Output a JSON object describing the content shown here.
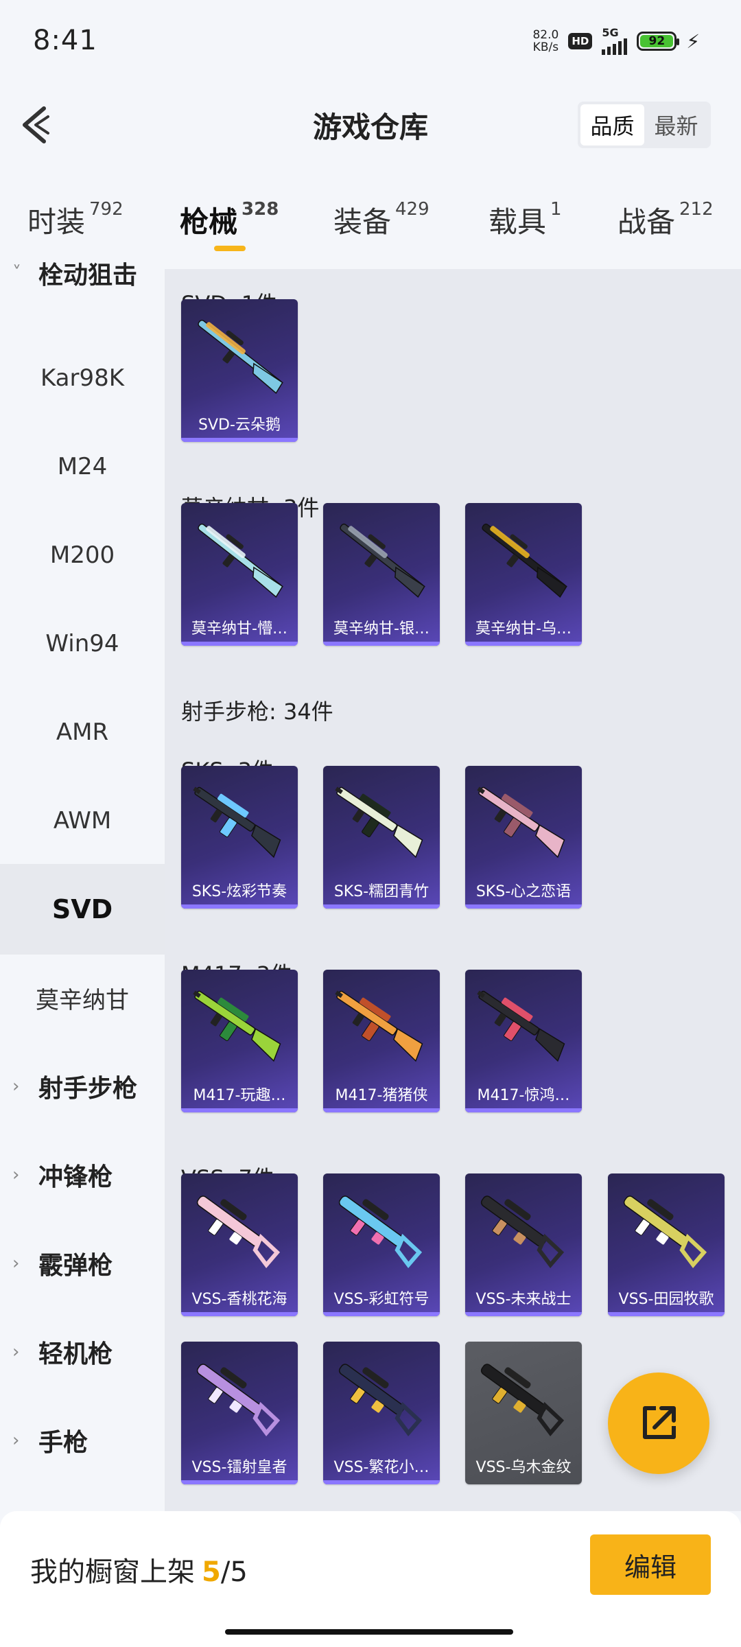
{
  "status_bar": {
    "time": "8:41",
    "net_speed_value": "82.0",
    "net_speed_unit": "KB/s",
    "hd": "HD",
    "network": "5G",
    "battery": "92"
  },
  "header": {
    "title": "游戏仓库",
    "sort_options": [
      "品质",
      "最新"
    ],
    "active_sort": "品质"
  },
  "tabs": [
    {
      "label": "时装",
      "count": "792"
    },
    {
      "label": "枪械",
      "count": "328",
      "active": true
    },
    {
      "label": "装备",
      "count": "429"
    },
    {
      "label": "载具",
      "count": "1"
    },
    {
      "label": "战备",
      "count": "212"
    }
  ],
  "sidebar": {
    "items": [
      {
        "label": "栓动狙击",
        "type": "group",
        "expanded": true
      },
      {
        "label": "Kar98K"
      },
      {
        "label": "M24"
      },
      {
        "label": "M200"
      },
      {
        "label": "Win94"
      },
      {
        "label": "AMR"
      },
      {
        "label": "AWM"
      },
      {
        "label": "SVD",
        "active": true
      },
      {
        "label": "莫辛纳甘"
      },
      {
        "label": "射手步枪",
        "type": "group"
      },
      {
        "label": "冲锋枪",
        "type": "group"
      },
      {
        "label": "霰弹枪",
        "type": "group"
      },
      {
        "label": "轻机枪",
        "type": "group"
      },
      {
        "label": "手枪",
        "type": "group"
      }
    ]
  },
  "content": {
    "sections": [
      {
        "title": "SVD: 1件",
        "items": [
          {
            "name": "SVD-云朵鹅",
            "color": "#7ec8e3",
            "accent": "#f0b040",
            "kind": "rifle"
          }
        ]
      },
      {
        "title": "莫辛纳甘: 3件",
        "items": [
          {
            "name": "莫辛纳甘-懵…",
            "color": "#a8e0e8",
            "accent": "#e8f4f8",
            "kind": "bolt"
          },
          {
            "name": "莫辛纳甘-银…",
            "color": "#3a3f4a",
            "accent": "#9aa3b0",
            "kind": "bolt"
          },
          {
            "name": "莫辛纳甘-乌…",
            "color": "#1e1e22",
            "accent": "#e8b420",
            "kind": "bolt"
          }
        ]
      },
      {
        "title": "射手步枪: 34件",
        "items": []
      },
      {
        "title": "SKS: 3件",
        "items": [
          {
            "name": "SKS-炫彩节奏",
            "color": "#2f3540",
            "accent": "#6ec8ff",
            "kind": "assault"
          },
          {
            "name": "SKS-糯团青竹",
            "color": "#e8efd8",
            "accent": "#1e2a1e",
            "kind": "assault"
          },
          {
            "name": "SKS-心之恋语",
            "color": "#e8b4c8",
            "accent": "#9a5a6a",
            "kind": "assault"
          }
        ]
      },
      {
        "title": "M417: 3件",
        "items": [
          {
            "name": "M417-玩趣…",
            "color": "#9ad43a",
            "accent": "#2c8a3c",
            "kind": "assault"
          },
          {
            "name": "M417-猪猪侠",
            "color": "#f0a040",
            "accent": "#c0502a",
            "kind": "assault"
          },
          {
            "name": "M417-惊鸿…",
            "color": "#2a2a30",
            "accent": "#e0506a",
            "kind": "assault"
          }
        ]
      },
      {
        "title": "VSS: 7件",
        "items": [
          {
            "name": "VSS-香桃花海",
            "color": "#f4c8d8",
            "accent": "#ffffff",
            "kind": "vss"
          },
          {
            "name": "VSS-彩虹符号",
            "color": "#6ac8f0",
            "accent": "#f070b0",
            "kind": "vss"
          },
          {
            "name": "VSS-未来战士",
            "color": "#2a2a2e",
            "accent": "#c89060",
            "kind": "vss"
          },
          {
            "name": "VSS-田园牧歌",
            "color": "#d8d060",
            "accent": "#ffffff",
            "kind": "vss"
          },
          {
            "name": "VSS-镭射皇者",
            "color": "#b890e0",
            "accent": "#f0e8ff",
            "kind": "vss"
          },
          {
            "name": "VSS-繁花小…",
            "color": "#2a3050",
            "accent": "#f0c040",
            "kind": "vss"
          },
          {
            "name": "VSS-乌木金纹",
            "color": "#1e1e20",
            "accent": "#e0b030",
            "kind": "vss",
            "gray": true
          }
        ]
      }
    ]
  },
  "fab": {
    "icon": "share-out-icon"
  },
  "bottom_bar": {
    "label": "我的橱窗上架",
    "current": "5",
    "total": "/5",
    "edit_label": "编辑"
  },
  "colors": {
    "accent": "#f8b318",
    "card": "#3a2f79",
    "card_bar": "#8b77ff"
  }
}
